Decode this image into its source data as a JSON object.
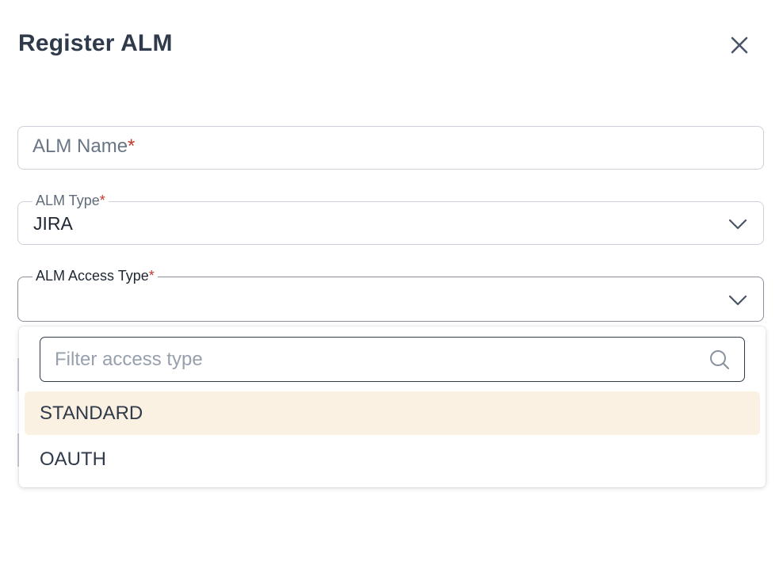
{
  "dialog": {
    "title": "Register ALM"
  },
  "fields": {
    "alm_name": {
      "placeholder": "ALM Name",
      "required_mark": "*"
    },
    "alm_type": {
      "label": "ALM Type",
      "required_mark": "*",
      "value": "JIRA"
    },
    "alm_access_type": {
      "label": "ALM Access Type",
      "required_mark": "*",
      "value": ""
    }
  },
  "dropdown": {
    "filter_placeholder": "Filter access type",
    "options": [
      {
        "label": "STANDARD",
        "highlighted": true
      },
      {
        "label": "OAUTH",
        "highlighted": false
      }
    ]
  },
  "colors": {
    "text": "#2f3a4a",
    "required": "#c0392b",
    "highlight": "#faf1e2",
    "border": "#cdd2da"
  },
  "icons": [
    "close-icon",
    "chevron-down-icon",
    "search-icon"
  ]
}
